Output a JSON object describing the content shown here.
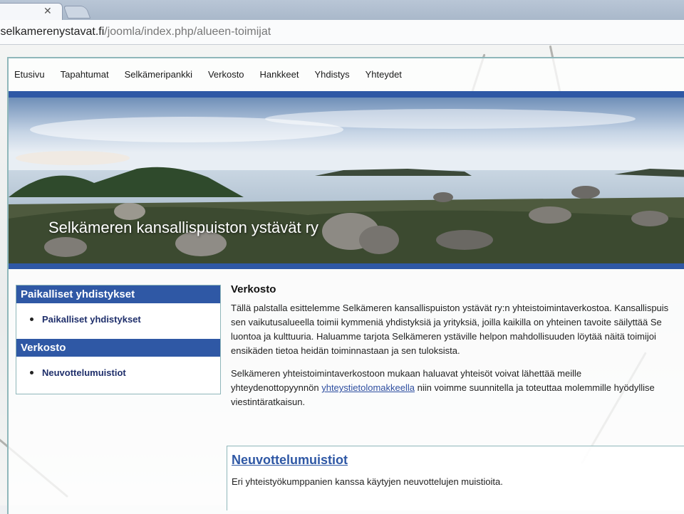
{
  "browser": {
    "url_domain": ".selkamerenystavat.fi",
    "url_path": "/joomla/index.php/alueen-toimijat"
  },
  "nav": [
    "Etusivu",
    "Tapahtumat",
    "Selkämeripankki",
    "Verkosto",
    "Hankkeet",
    "Yhdistys",
    "Yhteydet"
  ],
  "banner": {
    "title": "Selkämeren kansallispuiston ystävät ry"
  },
  "sidebar": {
    "sections": [
      {
        "heading": "Paikalliset yhdistykset",
        "link": "Paikalliset yhdistykset"
      },
      {
        "heading": "Verkosto",
        "link": "Neuvottelumuistiot"
      }
    ]
  },
  "main": {
    "heading": "Verkosto",
    "paragraph1": [
      "Tällä palstalla esittelemme Selkämeren kansallispuiston ystävät ry:n yhteistoimintaverkostoa. Kansallispuis",
      "sen vaikutusalueella toimii kymmeniä yhdistyksiä ja yrityksiä, joilla kaikilla on yhteinen tavoite säilyttää Se",
      "luontoa ja kulttuuria. Haluamme tarjota Selkämeren ystäville helpon mahdollisuuden löytää näitä toimijoi",
      "ensikäden tietoa heidän toiminnastaan ja sen tuloksista."
    ],
    "paragraph2_line1": "Selkämeren yhteistoimintaverkostoon mukaan haluavat yhteisöt voivat lähettää meille",
    "paragraph2_line2_pre": "yhteydenottopyynnön ",
    "paragraph2_link": "yhteystietolomakkeella",
    "paragraph2_line2_post": " niin voimme suunnitella ja toteuttaa molemmille hyödyllise",
    "paragraph2_line3": "viestintäratkaisun."
  },
  "article": {
    "title": "Neuvottelumuistiot",
    "description": "Eri yhteistyökumppanien kanssa käytyjen neuvottelujen muistioita."
  }
}
